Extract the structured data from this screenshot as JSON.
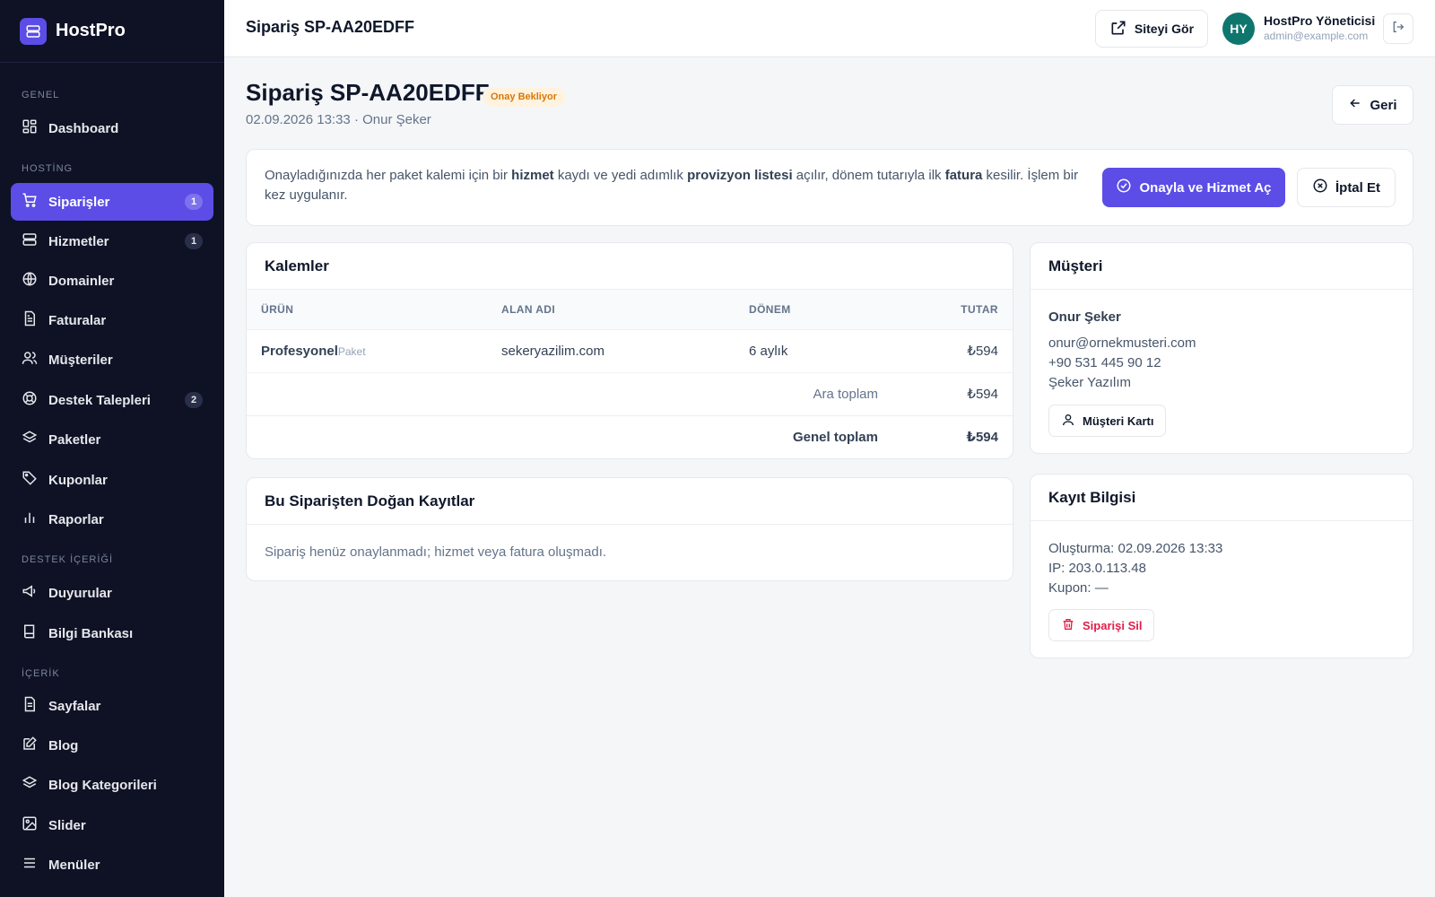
{
  "brand": {
    "name": "HostPro"
  },
  "sidebar": {
    "groups": {
      "general": "GENEL",
      "hosting": "HOSTİNG",
      "support_content": "DESTEK İÇERİĞİ",
      "content": "İÇERİK"
    },
    "items": [
      {
        "label": "Dashboard",
        "icon": "dashboard-icon"
      },
      {
        "label": "Siparişler",
        "icon": "cart-icon",
        "badge": "1",
        "active": true
      },
      {
        "label": "Hizmetler",
        "icon": "server-icon",
        "badge": "1"
      },
      {
        "label": "Domainler",
        "icon": "globe-icon"
      },
      {
        "label": "Faturalar",
        "icon": "invoice-icon"
      },
      {
        "label": "Müşteriler",
        "icon": "users-icon"
      },
      {
        "label": "Destek Talepleri",
        "icon": "lifebuoy-icon",
        "badge": "2"
      },
      {
        "label": "Paketler",
        "icon": "layers-icon"
      },
      {
        "label": "Kuponlar",
        "icon": "tag-icon"
      },
      {
        "label": "Raporlar",
        "icon": "bar-chart-icon"
      },
      {
        "label": "Duyurular",
        "icon": "megaphone-icon"
      },
      {
        "label": "Bilgi Bankası",
        "icon": "book-icon"
      },
      {
        "label": "Sayfalar",
        "icon": "page-icon"
      },
      {
        "label": "Blog",
        "icon": "edit-icon"
      },
      {
        "label": "Blog Kategorileri",
        "icon": "layers-icon"
      },
      {
        "label": "Slider",
        "icon": "image-icon"
      },
      {
        "label": "Menüler",
        "icon": "menu-icon"
      }
    ]
  },
  "topbar": {
    "title": "Sipariş SP-AA20EDFF",
    "site_button": "Siteyi Gör",
    "user": {
      "initials": "HY",
      "name": "HostPro Yöneticisi",
      "email": "admin@example.com"
    }
  },
  "header": {
    "title": "Sipariş SP-AA20EDFF",
    "status": "Onay Bekliyor",
    "subtitle": "02.09.2026 13:33 · Onur Şeker",
    "back_button": "Geri"
  },
  "notice": {
    "parts": [
      "Onayladığınızda her paket kalemi için bir ",
      "hizmet",
      " kaydı ve yedi adımlık ",
      "provizyon listesi",
      " açılır, dönem tutarıyla ilk ",
      "fatura",
      " kesilir. İşlem bir kez uygulanır."
    ],
    "approve_button": "Onayla ve Hizmet Aç",
    "cancel_button": "İptal Et"
  },
  "items_card": {
    "title": "Kalemler",
    "columns": [
      "ÜRÜN",
      "ALAN ADI",
      "DÖNEM",
      "TUTAR"
    ],
    "rows": [
      {
        "product": "Profesyonel",
        "type": "Paket",
        "domain": "sekeryazilim.com",
        "period": "6 aylık",
        "amount": "₺594"
      }
    ],
    "subtotal_label": "Ara toplam",
    "subtotal": "₺594",
    "total_label": "Genel toplam",
    "total": "₺594"
  },
  "records_card": {
    "title": "Bu Siparişten Doğan Kayıtlar",
    "empty_text": "Sipariş henüz onaylanmadı; hizmet veya fatura oluşmadı."
  },
  "customer_card": {
    "title": "Müşteri",
    "name": "Onur Şeker",
    "email": "onur@ornekmusteri.com",
    "phone": "+90 531 445 90 12",
    "company": "Şeker Yazılım",
    "button": "Müşteri Kartı"
  },
  "record_info_card": {
    "title": "Kayıt Bilgisi",
    "created": "Oluşturma: 02.09.2026 13:33",
    "ip": "IP: 203.0.113.48",
    "coupon": "Kupon: —",
    "delete_button": "Siparişi Sil"
  },
  "colors": {
    "accent": "#5b4de6",
    "sidebar_bg": "#0f1225",
    "status_warning": "#d97706",
    "danger": "#e11d48",
    "avatar": "#0f766e"
  }
}
